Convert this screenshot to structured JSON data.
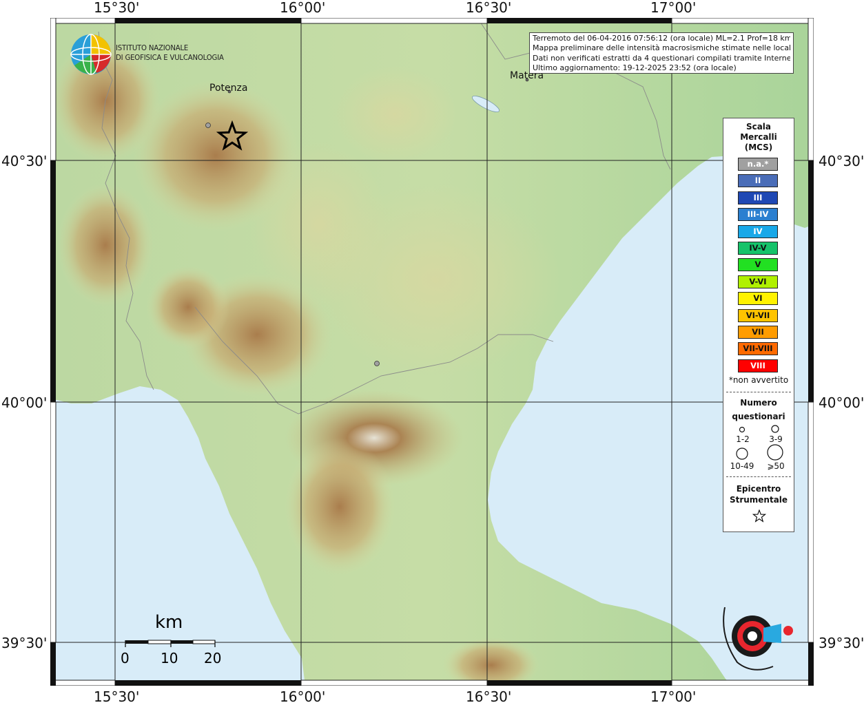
{
  "axes": {
    "lon_top": [
      "15°30'",
      "16°00'",
      "16°30'",
      "17°00'"
    ],
    "lon_bottom": [
      "15°30'",
      "16°00'",
      "16°30'",
      "17°00'"
    ],
    "lat_left": [
      "40°30'",
      "40°00'",
      "39°30'"
    ],
    "lat_right": [
      "40°30'",
      "40°00'",
      "39°30'"
    ]
  },
  "info_box": {
    "line1": "Terremoto del 06-04-2016 07:56:12 (ora locale) ML=2.1 Prof=18 km",
    "line2": "Mappa preliminare delle intensità macrosismiche stimate nelle località",
    "line3": "Dati non verificati estratti da 4 questionari compilati tramite Internet.",
    "line4": "Ultimo aggiornamento: 19-12-2025 23:52 (ora locale)"
  },
  "institute": {
    "line1": "ISTITUTO NAZIONALE",
    "line2": "DI GEOFISICA E VULCANOLOGIA"
  },
  "cities": {
    "potenza": "Potenza",
    "matera": "Matera"
  },
  "legend": {
    "title1": "Scala",
    "title2": "Mercalli",
    "title3": "(MCS)",
    "classes": [
      {
        "label": "n.a.*",
        "color": "#a0a0a0",
        "text_color": "#ffffff"
      },
      {
        "label": "II",
        "color": "#4a6db8",
        "text_color": "#ffffff"
      },
      {
        "label": "III",
        "color": "#1f48b4",
        "text_color": "#ffffff"
      },
      {
        "label": "III-IV",
        "color": "#2a7fd0",
        "text_color": "#ffffff"
      },
      {
        "label": "IV",
        "color": "#18a8e8",
        "text_color": "#ffffff"
      },
      {
        "label": "IV-V",
        "color": "#16c36a",
        "text_color": "#111111"
      },
      {
        "label": "V",
        "color": "#22e022",
        "text_color": "#111111"
      },
      {
        "label": "V-VI",
        "color": "#b0f000",
        "text_color": "#111111"
      },
      {
        "label": "VI",
        "color": "#fff200",
        "text_color": "#111111"
      },
      {
        "label": "VI-VII",
        "color": "#ffc400",
        "text_color": "#111111"
      },
      {
        "label": "VII",
        "color": "#ff9c00",
        "text_color": "#111111"
      },
      {
        "label": "VII-VIII",
        "color": "#ff6a00",
        "text_color": "#111111"
      },
      {
        "label": "VIII",
        "color": "#ff0000",
        "text_color": "#ffffff"
      }
    ],
    "footnote": "*non avvertito",
    "count_title1": "Numero",
    "count_title2": "questionari",
    "count_1_2": "1-2",
    "count_3_9": "3-9",
    "count_10_49": "10-49",
    "count_50": "⩾50",
    "epi_title1": "Epicentro",
    "epi_title2": "Strumentale"
  },
  "scalebar": {
    "unit": "km",
    "labels": [
      "0",
      "10",
      "20"
    ]
  },
  "colors": {
    "sea": "#d8ecf8",
    "land_low": "#a9d49a",
    "land_mid": "#d9d7a0",
    "land_high": "#b98d57",
    "grid": "#222222"
  }
}
